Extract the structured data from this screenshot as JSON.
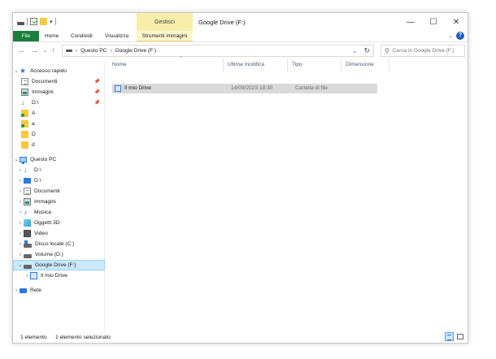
{
  "window": {
    "title": "Google Drive (F:)",
    "contextual_tab_group": "Gestisci",
    "controls": {
      "minimize": "—",
      "maximize": "☐",
      "close": "✕"
    }
  },
  "ribbon": {
    "tabs": [
      "File",
      "Home",
      "Condividi",
      "Visualizza",
      "Strumenti immagini"
    ],
    "expand_icon": "chevron-down-icon",
    "help": "?"
  },
  "address": {
    "crumbs": [
      "Questo PC",
      "Google Drive (F:)"
    ],
    "search_placeholder": "Cerca in Google Drive (F:)"
  },
  "nav": {
    "items": [
      {
        "label": "Accesso rapido",
        "icon": "star-icon",
        "expander": "⌄",
        "pinned": false
      },
      {
        "label": "Documenti",
        "icon": "documents-icon",
        "expander": "",
        "pinned": true
      },
      {
        "label": "Immagini",
        "icon": "pictures-icon",
        "expander": "",
        "pinned": true
      },
      {
        "label": "D:\\",
        "icon": "download-icon",
        "expander": "",
        "pinned": true
      },
      {
        "label": "A",
        "icon": "folder-icon",
        "expander": "",
        "pinned": false
      },
      {
        "label": "a",
        "icon": "folder-icon",
        "expander": "",
        "pinned": false
      },
      {
        "label": "D",
        "icon": "folder-icon",
        "expander": "",
        "pinned": false
      },
      {
        "label": "d",
        "icon": "folder-icon",
        "expander": "",
        "pinned": false
      },
      {
        "label": "Questo PC",
        "icon": "computer-icon",
        "expander": "⌄",
        "pinned": false
      },
      {
        "label": "D:\\",
        "icon": "download-icon",
        "expander": "›",
        "pinned": false
      },
      {
        "label": "D:\\",
        "icon": "desktop-icon",
        "expander": "›",
        "pinned": false
      },
      {
        "label": "Documenti",
        "icon": "documents-icon",
        "expander": "›",
        "pinned": false
      },
      {
        "label": "Immagini",
        "icon": "pictures-icon",
        "expander": "›",
        "pinned": false
      },
      {
        "label": "Musica",
        "icon": "music-icon",
        "expander": "›",
        "pinned": false
      },
      {
        "label": "Oggetti 3D",
        "icon": "3d-objects-icon",
        "expander": "›",
        "pinned": false
      },
      {
        "label": "Video",
        "icon": "video-icon",
        "expander": "›",
        "pinned": false
      },
      {
        "label": "Disco locale (C:)",
        "icon": "system-disk-icon",
        "expander": "›",
        "pinned": false
      },
      {
        "label": "Volume (D:)",
        "icon": "disk-icon",
        "expander": "›",
        "pinned": false
      },
      {
        "label": "Google Drive (F:)",
        "icon": "disk-icon",
        "expander": "⌄",
        "pinned": false,
        "selected": true
      },
      {
        "label": "Il mio Drive",
        "icon": "shared-drive-icon",
        "expander": "›",
        "pinned": false
      },
      {
        "label": "Rete",
        "icon": "network-icon",
        "expander": "›",
        "pinned": false
      }
    ]
  },
  "columns": [
    "Nome",
    "Ultima modifica",
    "Tipo",
    "Dimensione"
  ],
  "files": [
    {
      "name": "Il mio Drive",
      "modified": "14/09/2023 18:30",
      "type": "Cartella di file",
      "size": ""
    }
  ],
  "status": {
    "count": "1 elemento",
    "selected": "1 elemento selezionato"
  },
  "colors": {
    "file_tab": "#1a7f3c",
    "context_tab": "#f8eeaa",
    "selection": "#cce8ff",
    "row_selected": "#d9d9d9",
    "accent": "#2b78e4"
  }
}
